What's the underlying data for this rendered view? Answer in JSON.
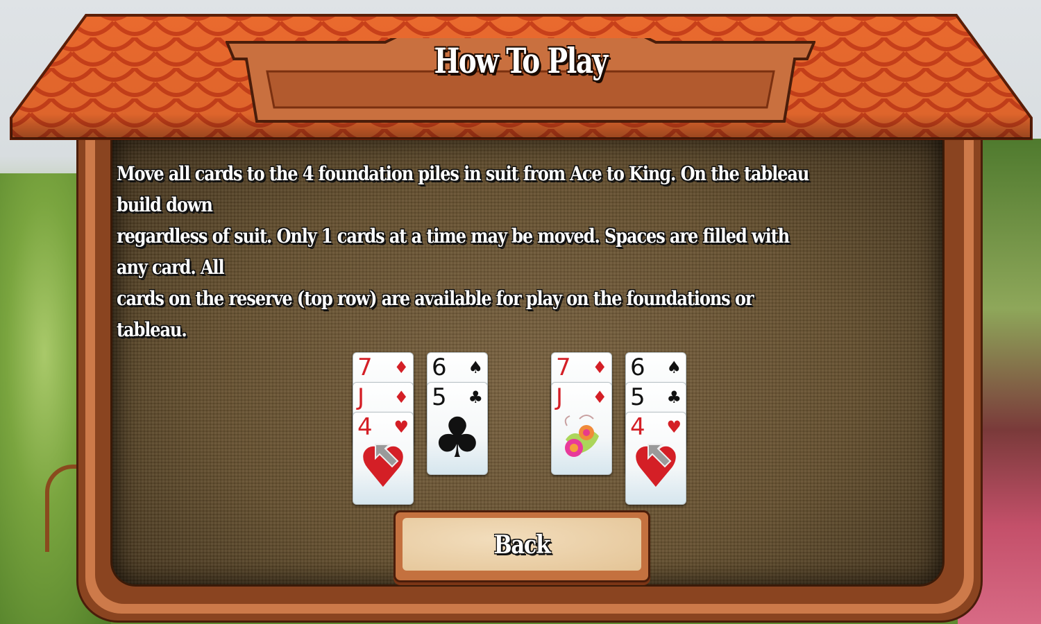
{
  "screen": {
    "title": "How To Play",
    "instructions": "Move all cards to the 4 foundation piles in suit from Ace to King. On the tableau build down\nregardless of suit. Only 1 cards at a time may be moved. Spaces are filled with any card. All\ncards on the reserve (top row) are available for play on the foundations or tableau.",
    "back_button": "Back"
  },
  "demo": {
    "before": {
      "piles": [
        {
          "cards": [
            {
              "rank": "7",
              "suit": "♦",
              "color": "red"
            },
            {
              "rank": "J",
              "suit": "♦",
              "color": "red"
            },
            {
              "rank": "4",
              "suit": "♥",
              "color": "red",
              "face": "♥",
              "overlay": "drag-arrow"
            }
          ]
        },
        {
          "cards": [
            {
              "rank": "6",
              "suit": "♠",
              "color": "black"
            },
            {
              "rank": "5",
              "suit": "♣",
              "color": "black",
              "face": "♣"
            }
          ]
        }
      ]
    },
    "after": {
      "piles": [
        {
          "cards": [
            {
              "rank": "7",
              "suit": "♦",
              "color": "red"
            },
            {
              "rank": "J",
              "suit": "♦",
              "color": "red",
              "face": "flower-design"
            }
          ]
        },
        {
          "cards": [
            {
              "rank": "6",
              "suit": "♠",
              "color": "black"
            },
            {
              "rank": "5",
              "suit": "♣",
              "color": "black"
            },
            {
              "rank": "4",
              "suit": "♥",
              "color": "red",
              "face": "♥",
              "overlay": "drag-arrow"
            }
          ]
        }
      ]
    }
  },
  "colors": {
    "roof": "#e8622a",
    "frame": "#cd7a4a",
    "button_face": "#ecd3ac",
    "card_red": "#d41f26"
  }
}
